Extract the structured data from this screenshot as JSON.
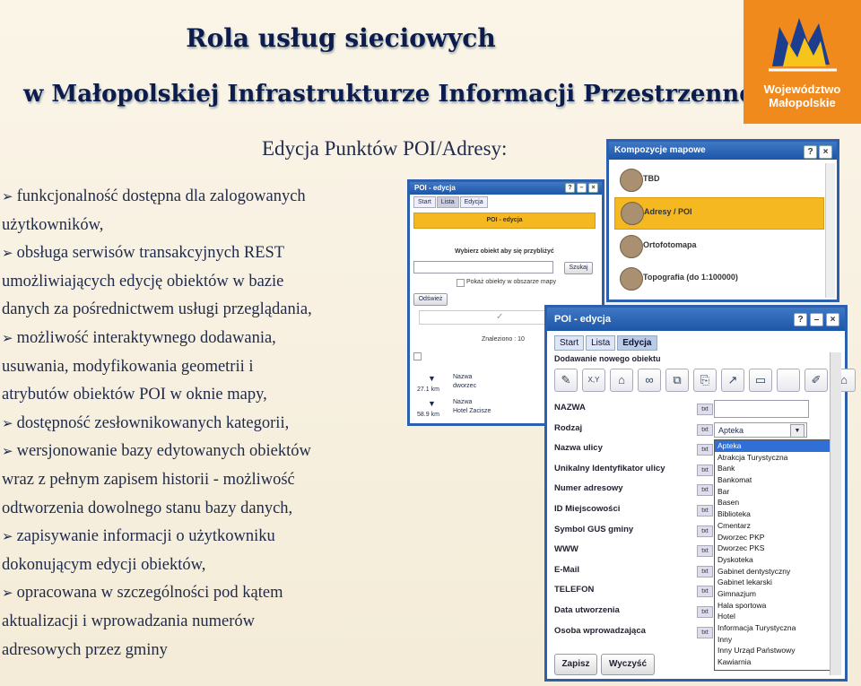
{
  "slide": {
    "title_line1": "Rola usług sieciowych",
    "title_line2": "w Małopolskiej Infrastrukturze Informacji Przestrzennej",
    "subtitle": "Edycja Punktów POI/Adresy:"
  },
  "logo": {
    "line1": "Województwo",
    "line2": "Małopolskie",
    "color": "#f08a1d"
  },
  "bullets": {
    "arrow_icon": "arrow-bullet-icon",
    "lines": [
      {
        "bullet": true,
        "text": "funkcjonalność dostępna dla zalogowanych"
      },
      {
        "bullet": false,
        "text": "użytkowników,"
      },
      {
        "bullet": true,
        "text": "obsługa serwisów transakcyjnych REST"
      },
      {
        "bullet": false,
        "text": "umożliwiających edycję obiektów w bazie"
      },
      {
        "bullet": false,
        "text": "danych za pośrednictwem usługi przeglądania,"
      },
      {
        "bullet": true,
        "text": "możliwość interaktywnego dodawania,"
      },
      {
        "bullet": false,
        "text": "usuwania, modyfikowania geometrii i"
      },
      {
        "bullet": false,
        "text": "atrybutów obiektów POI w oknie mapy,"
      },
      {
        "bullet": true,
        "text": "dostępność zesłownikowanych kategorii,"
      },
      {
        "bullet": true,
        "text": "wersjonowanie bazy edytowanych obiektów"
      },
      {
        "bullet": false,
        "text": "wraz z pełnym zapisem historii - możliwość"
      },
      {
        "bullet": false,
        "text": "odtworzenia dowolnego stanu bazy danych,"
      },
      {
        "bullet": true,
        "text": "zapisywanie informacji o użytkowniku"
      },
      {
        "bullet": false,
        "text": "dokonującym edycji obiektów,"
      },
      {
        "bullet": true,
        "text": "opracowana w szczególności pod kątem"
      },
      {
        "bullet": false,
        "text": "aktualizacji i wprowadzania numerów"
      },
      {
        "bullet": false,
        "text": "adresowych przez gminy"
      }
    ]
  },
  "window_compositions": {
    "title": "Kompozycje mapowe",
    "help_label": "?",
    "close_label": "×",
    "items": [
      {
        "label": "TBD",
        "selected": false
      },
      {
        "label": "Adresy / POI",
        "selected": true
      },
      {
        "label": "Ortofotomapa",
        "selected": false
      },
      {
        "label": "Topografia (do 1:100000)",
        "selected": false
      }
    ]
  },
  "window_poi_list": {
    "title": "POI - edycja",
    "help_label": "?",
    "min_label": "–",
    "close_label": "×",
    "tabs": [
      {
        "label": "Start",
        "active": false
      },
      {
        "label": "Lista",
        "active": true
      },
      {
        "label": "Edycja",
        "active": false
      }
    ],
    "header": "POI - edycja",
    "prompt": "Wybierz obiekt aby się przybliżyć",
    "search_button": "Szukaj",
    "refresh_button": "Odśwież",
    "show_in_area": "Pokaż obiekty w obszarze mapy",
    "found": "Znaleziono : 10",
    "results": [
      {
        "distance": "27.1 km",
        "name_label": "Nazwa",
        "name": "dworzec"
      },
      {
        "distance": "58.9 km",
        "name_label": "Nazwa",
        "name": "Hotel Zacisze"
      }
    ]
  },
  "window_poi_edit": {
    "title": "POI - edycja",
    "help_label": "?",
    "min_label": "–",
    "close_label": "×",
    "tabs": [
      {
        "label": "Start",
        "active": false
      },
      {
        "label": "Lista",
        "active": false
      },
      {
        "label": "Edycja",
        "active": true
      }
    ],
    "section_title": "Dodawanie nowego obiektu",
    "tools": [
      {
        "icon": "pencil-icon",
        "glyph": "✎"
      },
      {
        "icon": "xy-coordinates-icon",
        "glyph": "X,Y"
      },
      {
        "icon": "add-point-icon",
        "glyph": "⌂"
      },
      {
        "icon": "link-icon",
        "glyph": "∞"
      },
      {
        "icon": "copy-icon",
        "glyph": "⧉"
      },
      {
        "icon": "paste-icon",
        "glyph": "⎘"
      },
      {
        "icon": "move-icon",
        "glyph": "↗"
      },
      {
        "icon": "map-view-icon",
        "glyph": "▭"
      },
      {
        "icon": "blank-icon",
        "glyph": ""
      },
      {
        "icon": "edit-form-icon",
        "glyph": "✐"
      },
      {
        "icon": "save-point-icon",
        "glyph": "⌂"
      }
    ],
    "txt_label": "txt",
    "fields": [
      {
        "label": "NAZWA"
      },
      {
        "label": "Rodzaj"
      },
      {
        "label": "Nazwa ulicy"
      },
      {
        "label": "Unikalny Identyfikator ulicy"
      },
      {
        "label": "Numer adresowy"
      },
      {
        "label": "ID Miejscowości"
      },
      {
        "label": "Symbol GUS gminy"
      },
      {
        "label": "WWW"
      },
      {
        "label": "E-Mail"
      },
      {
        "label": "TELEFON"
      },
      {
        "label": "Data utworzenia"
      },
      {
        "label": "Osoba wprowadzająca"
      }
    ],
    "rodzaj_value": "Apteka",
    "dropdown_arrow": "▼",
    "options": [
      "Apteka",
      "Atrakcja Turystyczna",
      "Bank",
      "Bankomat",
      "Bar",
      "Basen",
      "Biblioteka",
      "Cmentarz",
      "Dworzec PKP",
      "Dworzec PKS",
      "Dyskoteka",
      "Gabinet dentystyczny",
      "Gabinet lekarski",
      "Gimnazjum",
      "Hala sportowa",
      "Hotel",
      "Informacja Turystyczna",
      "Inny",
      "Inny Urząd Państwowy",
      "Kawiarnia"
    ],
    "selected_option": "Apteka",
    "save_button": "Zapisz",
    "clear_button": "Wyczyść"
  }
}
